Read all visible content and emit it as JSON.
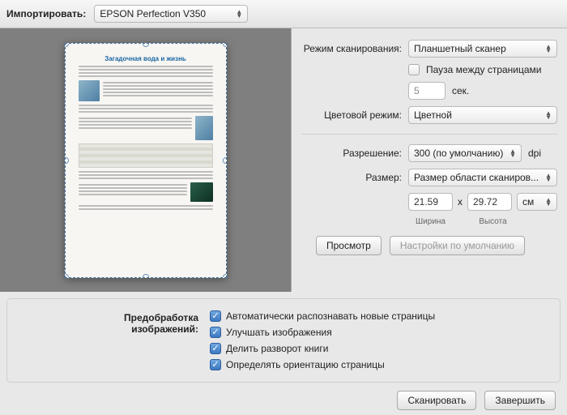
{
  "toolbar": {
    "import_label": "Импортировать:",
    "scanner": "EPSON Perfection V350"
  },
  "preview": {
    "doc_title": "Загадочная вода и жизнь"
  },
  "settings": {
    "scan_mode_label": "Режим сканирования:",
    "scan_mode_value": "Планшетный сканер",
    "pause_label": "Пауза между страницами",
    "pause_seconds": "5",
    "pause_unit": "сек.",
    "color_mode_label": "Цветовой режим:",
    "color_mode_value": "Цветной",
    "resolution_label": "Разрешение:",
    "resolution_value": "300 (по умолчанию)",
    "resolution_unit": "dpi",
    "size_label": "Размер:",
    "size_value": "Размер области сканиров...",
    "width_value": "21.59",
    "times": "x",
    "height_value": "29.72",
    "unit_value": "см",
    "width_caption": "Ширина",
    "height_caption": "Высота",
    "preview_btn": "Просмотр",
    "defaults_btn": "Настройки по умолчанию"
  },
  "prep": {
    "label_line1": "Предобработка",
    "label_line2": "изображений:",
    "opts": [
      {
        "label": "Автоматически распознавать новые страницы",
        "checked": true
      },
      {
        "label": "Улучшать изображения",
        "checked": true
      },
      {
        "label": "Делить разворот книги",
        "checked": true
      },
      {
        "label": "Определять ориентацию страницы",
        "checked": true
      }
    ]
  },
  "footer": {
    "scan": "Сканировать",
    "finish": "Завершить"
  }
}
